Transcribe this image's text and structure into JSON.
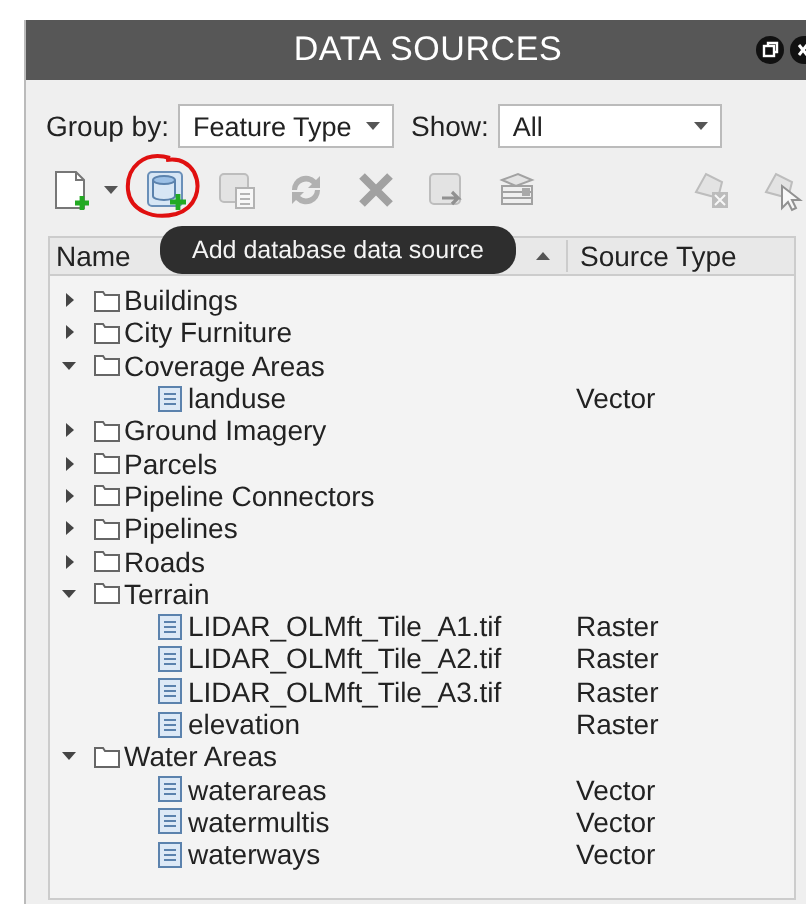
{
  "window": {
    "title": "DATA SOURCES"
  },
  "filters": [
    {
      "label": "Group by:",
      "value": "Feature Type"
    },
    {
      "label": "Show:",
      "value": "All"
    }
  ],
  "toolbar": [
    {
      "kind": "new-file",
      "disabled": false,
      "annotated": false
    },
    {
      "kind": "database",
      "disabled": false,
      "annotated": true
    },
    {
      "kind": "properties",
      "disabled": true,
      "annotated": false
    },
    {
      "kind": "refresh",
      "disabled": true,
      "annotated": false
    },
    {
      "kind": "delete",
      "disabled": true,
      "annotated": false
    },
    {
      "kind": "import",
      "disabled": true,
      "annotated": false
    },
    {
      "kind": "table",
      "disabled": true,
      "annotated": false
    },
    {
      "kind": "shape-remove",
      "disabled": true,
      "annotated": false
    },
    {
      "kind": "shape-select",
      "disabled": true,
      "annotated": false
    }
  ],
  "tooltip": {
    "text": "Add database data source"
  },
  "columns": [
    "Name",
    "Source Type"
  ],
  "tree": [
    {
      "name": "Buildings",
      "expanded": false
    },
    {
      "name": "City Furniture",
      "expanded": false
    },
    {
      "name": "Coverage Areas",
      "expanded": true,
      "children": [
        {
          "name": "landuse",
          "source_type": "Vector"
        }
      ]
    },
    {
      "name": "Ground Imagery",
      "expanded": false
    },
    {
      "name": "Parcels",
      "expanded": false
    },
    {
      "name": "Pipeline Connectors",
      "expanded": false
    },
    {
      "name": "Pipelines",
      "expanded": false
    },
    {
      "name": "Roads",
      "expanded": false
    },
    {
      "name": "Terrain",
      "expanded": true,
      "children": [
        {
          "name": "LIDAR_OLMft_Tile_A1.tif",
          "source_type": "Raster"
        },
        {
          "name": "LIDAR_OLMft_Tile_A2.tif",
          "source_type": "Raster"
        },
        {
          "name": "LIDAR_OLMft_Tile_A3.tif",
          "source_type": "Raster"
        },
        {
          "name": "elevation",
          "source_type": "Raster"
        }
      ]
    },
    {
      "name": "Water Areas",
      "expanded": true,
      "children": [
        {
          "name": "waterareas",
          "source_type": "Vector"
        },
        {
          "name": "watermultis",
          "source_type": "Vector"
        },
        {
          "name": "waterways",
          "source_type": "Vector"
        }
      ]
    }
  ]
}
